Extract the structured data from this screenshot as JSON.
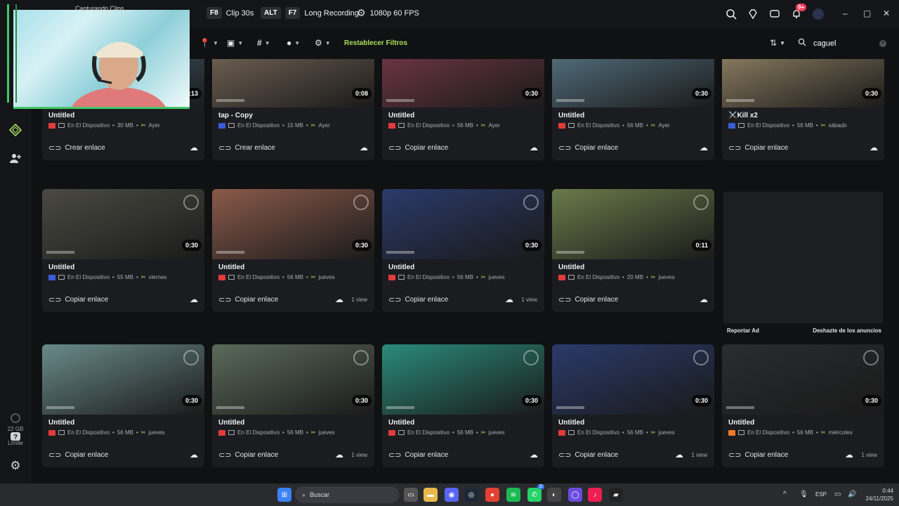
{
  "webcam": {
    "capturing_label": "Capturando Clips"
  },
  "hotkeys": [
    {
      "key": "F8",
      "label": "Clip 30s"
    },
    {
      "key": "ALT",
      "label": ""
    },
    {
      "key": "F7",
      "label": "Long Recording"
    }
  ],
  "quality": {
    "label": "1080p 60 FPS"
  },
  "notifications": {
    "count": "9+"
  },
  "filters": {
    "reset_label": "Restablecer Filtros",
    "search_value": "caguel"
  },
  "storage": {
    "amount": "22 GB",
    "plan_line1": "Sin",
    "plan_line2": "Límite"
  },
  "clips": [
    {
      "title": "Untitled",
      "game_color": "#e23b3b",
      "device": "En El Dispositivo",
      "size": "30 MB",
      "date": "Ayer",
      "duration": "0:13",
      "action": "Crear enlace",
      "views": "",
      "thumb": "#4a6a7a"
    },
    {
      "title": "tap - Copy",
      "game_color": "#3b5bd6",
      "device": "En El Dispositivo",
      "size": "15 MB",
      "date": "Ayer",
      "duration": "0:08",
      "action": "Crear enlace",
      "views": "",
      "thumb": "#7a6a5a"
    },
    {
      "title": "Untitled",
      "game_color": "#e23b3b",
      "device": "En El Dispositivo",
      "size": "56 MB",
      "date": "Ayer",
      "duration": "0:30",
      "action": "Copiar enlace",
      "views": "",
      "thumb": "#7a3a4a"
    },
    {
      "title": "Untitled",
      "game_color": "#e23b3b",
      "device": "En El Dispositivo",
      "size": "56 MB",
      "date": "Ayer",
      "duration": "0:30",
      "action": "Copiar enlace",
      "views": "",
      "thumb": "#5a7a8a"
    },
    {
      "title": "⚔️Kill x2",
      "game_color": "#3b5bd6",
      "device": "En El Dispositivo",
      "size": "56 MB",
      "date": "sábado",
      "duration": "0:30",
      "action": "Copiar enlace",
      "views": "",
      "thumb": "#9a8a6a"
    },
    {
      "title": "Untitled",
      "game_color": "#3b5bd6",
      "device": "En El Dispositivo",
      "size": "55 MB",
      "date": "viernes",
      "duration": "0:30",
      "action": "Copiar enlace",
      "views": "",
      "thumb": "#4a4a42"
    },
    {
      "title": "Untitled",
      "game_color": "#e23b3b",
      "device": "En El Dispositivo",
      "size": "56 MB",
      "date": "jueves",
      "duration": "0:30",
      "action": "Copiar enlace",
      "views": "1 view",
      "thumb": "#8a5a4a"
    },
    {
      "title": "Untitled",
      "game_color": "#e23b3b",
      "device": "En El Dispositivo",
      "size": "56 MB",
      "date": "jueves",
      "duration": "0:30",
      "action": "Copiar enlace",
      "views": "1 view",
      "thumb": "#2a3a6a"
    },
    {
      "title": "Untitled",
      "game_color": "#e23b3b",
      "device": "En El Dispositivo",
      "size": "20 MB",
      "date": "jueves",
      "duration": "0:11",
      "action": "Copiar enlace",
      "views": "",
      "thumb": "#6a7a4a"
    },
    {
      "title": "Untitled",
      "game_color": "#e23b3b",
      "device": "En El Dispositivo",
      "size": "56 MB",
      "date": "jueves",
      "duration": "0:30",
      "action": "Copiar enlace",
      "views": "",
      "thumb": "#6a8a8a"
    },
    {
      "title": "Untitled",
      "game_color": "#e23b3b",
      "device": "En El Dispositivo",
      "size": "56 MB",
      "date": "jueves",
      "duration": "0:30",
      "action": "Copiar enlace",
      "views": "1 view",
      "thumb": "#5a6a5a"
    },
    {
      "title": "Untitled",
      "game_color": "#e23b3b",
      "device": "En El Dispositivo",
      "size": "56 MB",
      "date": "jueves",
      "duration": "0:30",
      "action": "Copiar enlace",
      "views": "",
      "thumb": "#2a8a7a"
    },
    {
      "title": "Untitled",
      "game_color": "#e23b3b",
      "device": "En El Dispositivo",
      "size": "56 MB",
      "date": "jueves",
      "duration": "0:30",
      "action": "Copiar enlace",
      "views": "1 view",
      "thumb": "#2a3a6a"
    },
    {
      "title": "Untitled",
      "game_color": "#f07a2a",
      "device": "En El Dispositivo",
      "size": "56 MB",
      "date": "miércoles",
      "duration": "0:30",
      "action": "Copiar enlace",
      "views": "1 view",
      "thumb": "#2a2c2e"
    }
  ],
  "ad": {
    "report_label": "Reportar Ad",
    "remove_label": "Deshazte de los anuncios"
  },
  "taskbar": {
    "search_label": "Buscar",
    "lang": "ESP",
    "time": "0:44",
    "date": "24/11/2025",
    "whatsapp_badge": "2"
  }
}
